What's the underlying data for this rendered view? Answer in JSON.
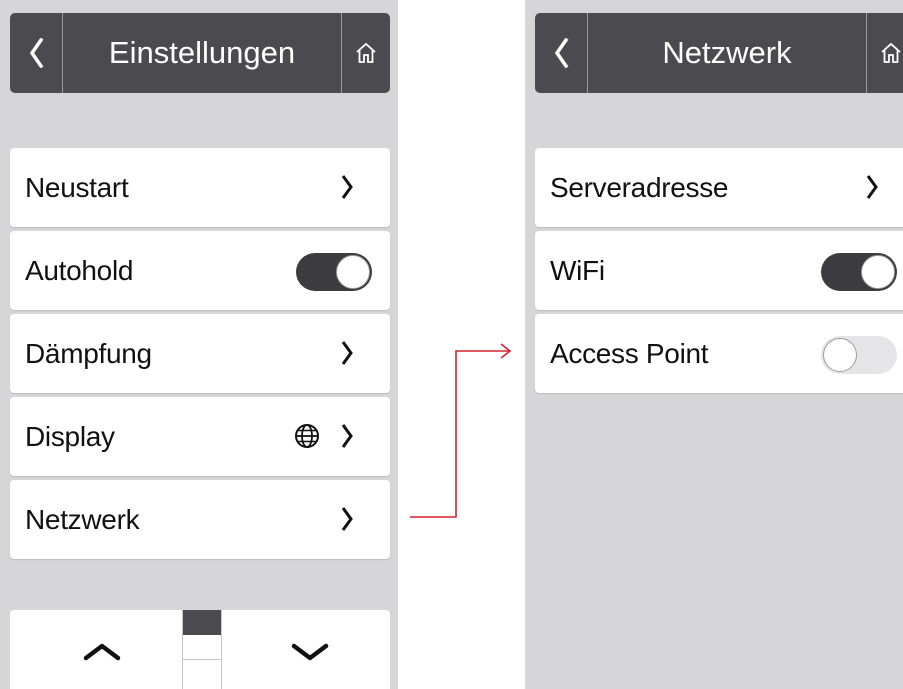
{
  "left_screen": {
    "title": "Einstellungen",
    "items": [
      {
        "label": "Neustart",
        "control": "chevron"
      },
      {
        "label": "Autohold",
        "control": "toggle",
        "state": "on"
      },
      {
        "label": "Dämpfung",
        "control": "chevron"
      },
      {
        "label": "Display",
        "control": "chevron",
        "extra_icon": "globe-icon"
      },
      {
        "label": "Netzwerk",
        "control": "chevron"
      }
    ],
    "pager": {
      "page": 1,
      "pages": 3
    }
  },
  "right_screen": {
    "title": "Netzwerk",
    "items": [
      {
        "label": "Serveradresse",
        "control": "chevron"
      },
      {
        "label": "WiFi",
        "control": "toggle",
        "state": "on"
      },
      {
        "label": "Access Point",
        "control": "toggle",
        "state": "off"
      }
    ]
  },
  "colors": {
    "header": "#4b4a4f",
    "background": "#d6d5d8",
    "connector": "#d9232d",
    "toggle_on": "#3c3b40"
  },
  "icons": [
    "back-chevron-icon",
    "home-icon",
    "chevron-right-icon",
    "globe-icon",
    "chevron-up-icon",
    "chevron-down-icon"
  ]
}
